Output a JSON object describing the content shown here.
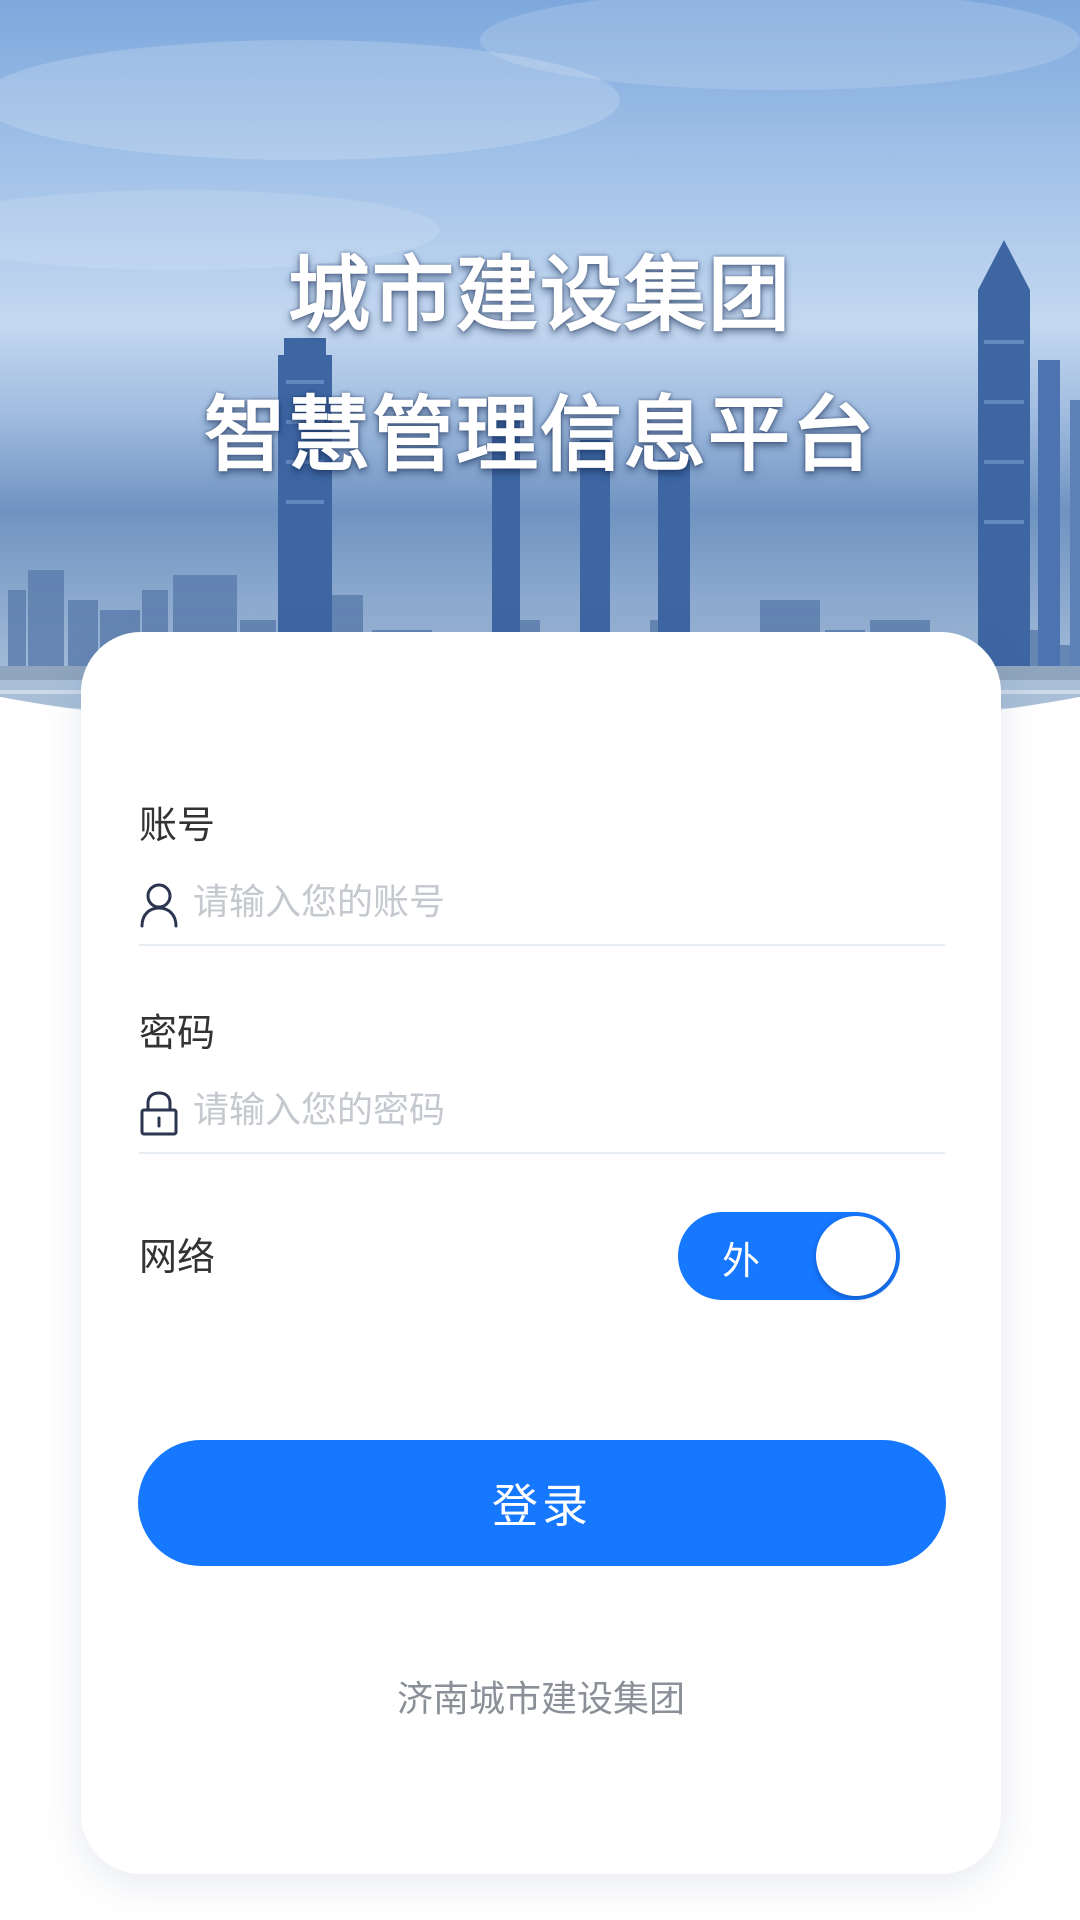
{
  "hero": {
    "title_line1": "城市建设集团",
    "title_line2": "智慧管理信息平台"
  },
  "form": {
    "account": {
      "label": "账号",
      "placeholder": "请输入您的账号",
      "value": "",
      "icon": "user-icon"
    },
    "password": {
      "label": "密码",
      "placeholder": "请输入您的密码",
      "value": "",
      "icon": "lock-icon"
    },
    "network": {
      "label": "网络",
      "toggle_text": "外",
      "toggle_on": true
    },
    "login_button_label": "登录"
  },
  "footer": {
    "company": "济南城市建设集团"
  },
  "colors": {
    "primary": "#1677ff",
    "label_text": "#333333",
    "placeholder": "#c4c8cf",
    "footer_text": "#8a8f98"
  }
}
